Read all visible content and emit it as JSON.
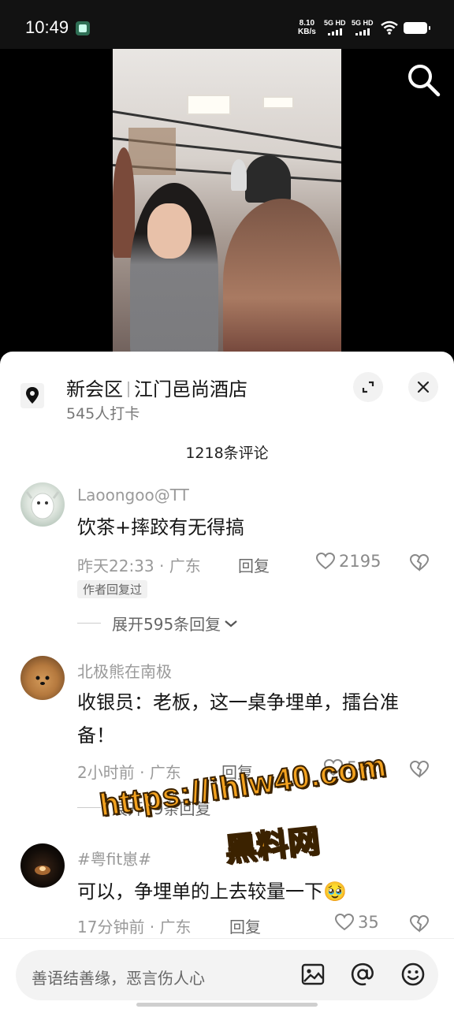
{
  "status_bar": {
    "time": "10:49",
    "net_speed_value": "8.10",
    "net_speed_unit": "KB/s",
    "sim1": "5G HD",
    "sim2": "5G HD"
  },
  "location": {
    "district": "新会区",
    "venue": "江门邑尚酒店",
    "checkins": "545人打卡"
  },
  "comments_count": "1218条评论",
  "comments": [
    {
      "user": "Laoongoo@TT",
      "text": "饮茶+摔跤有无得搞",
      "time_region": "昨天22:33 · 广东",
      "reply_label": "回复",
      "likes": "2195",
      "badge": "作者回复过",
      "expand": "展开595条回复"
    },
    {
      "user": "北极熊在南极",
      "text": "收银员：老板，这一桌争埋单，擂台准备！",
      "time_region": "2小时前 · 广东",
      "reply_label": "回复",
      "likes": "542",
      "expand": "展开79条回复"
    },
    {
      "user": "#粤fit崽#",
      "text": "可以，争埋单的上去较量一下🥹",
      "time_region": "17分钟前 · 广东",
      "reply_label": "回复",
      "likes": "35"
    }
  ],
  "watermark": {
    "url": "https://ihlw40.com",
    "name": "黑料网"
  },
  "input": {
    "placeholder": "善语结善缘，恶言伤人心"
  },
  "icons": [
    "search-icon",
    "location-pin-icon",
    "minimize-icon",
    "close-icon",
    "heart-icon",
    "broken-heart-icon",
    "chevron-down-icon",
    "image-icon",
    "at-icon",
    "emoji-icon"
  ]
}
